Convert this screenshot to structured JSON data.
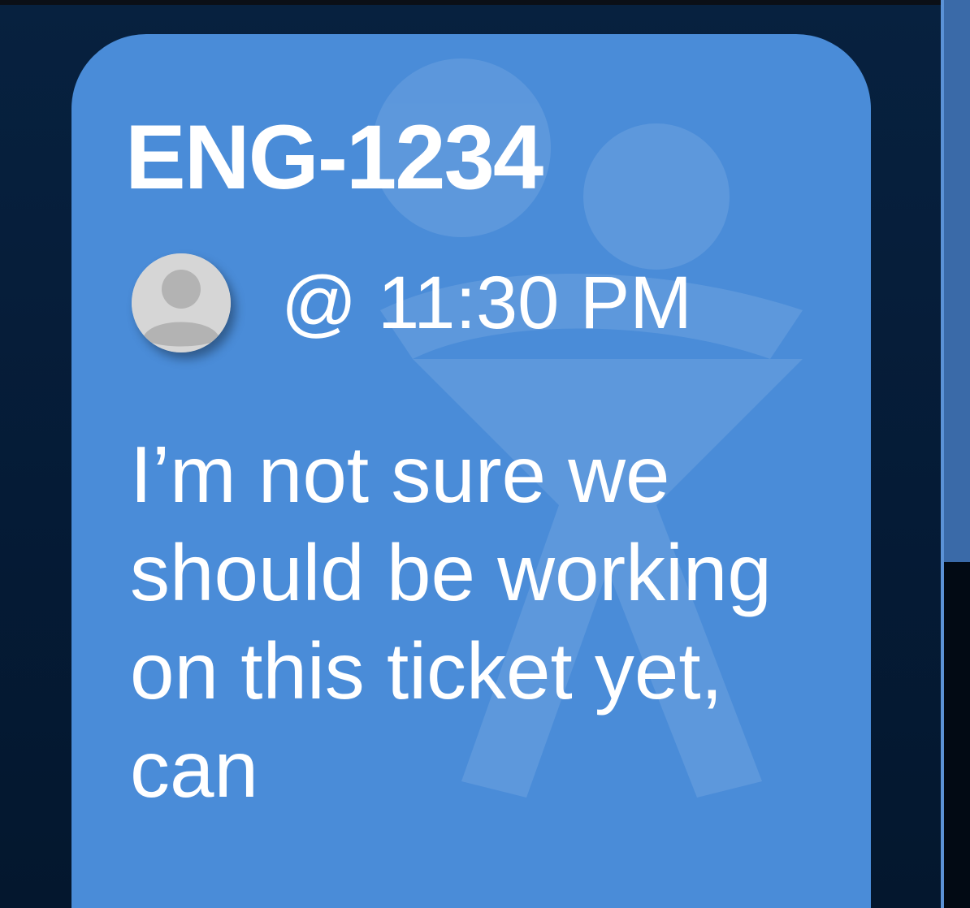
{
  "ticket": {
    "id": "ENG-1234",
    "timestamp": "@ 11:30 PM",
    "message": "I’m not sure we should be working on this ticket yet, can"
  },
  "author": {
    "avatar_icon": "default-user-avatar-icon"
  },
  "colors": {
    "card_background": "#4a8cd8",
    "page_background": "#051a33",
    "text": "#ffffff",
    "avatar": "#d9d9d9"
  }
}
